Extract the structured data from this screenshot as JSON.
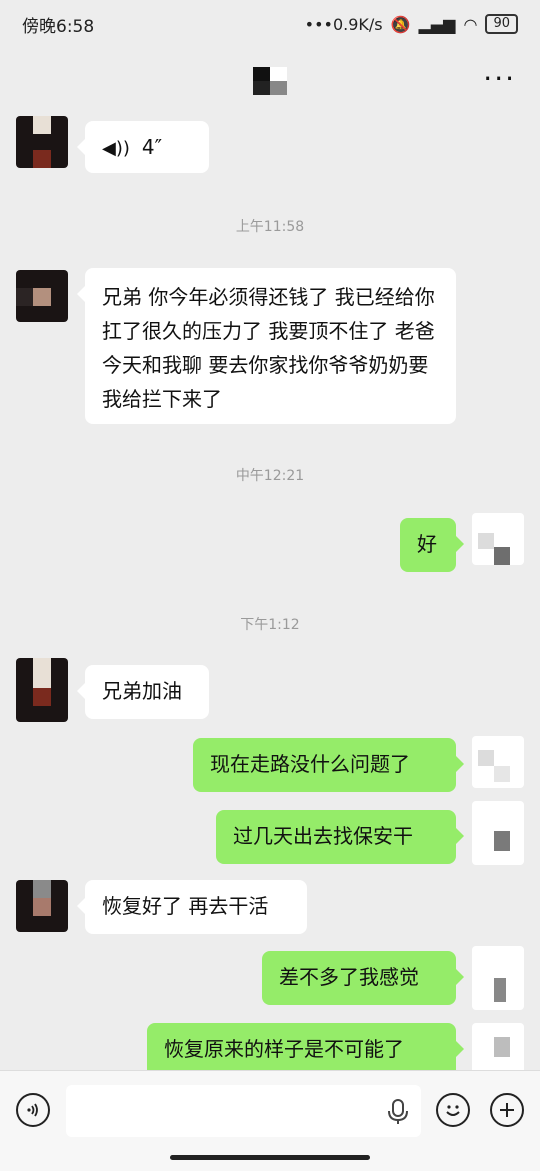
{
  "status": {
    "time": "傍晚6:58",
    "speed": "•••0.9K/s",
    "battery": "90"
  },
  "messages": {
    "voice_duration": "4″",
    "ts1": "上午11:58",
    "m1": "兄弟 你今年必须得还钱了 我已经给你扛了很久的压力了 我要顶不住了 老爸今天和我聊 要去你家找你爷爷奶奶要 我给拦下来了",
    "ts2": "中午12:21",
    "m2": "好",
    "ts3": "下午1:12",
    "m3": "兄弟加油",
    "m4": "现在走路没什么问题了",
    "m5": "过几天出去找保安干",
    "m6": "恢复好了 再去干活",
    "m7": "差不多了我感觉",
    "m8": "恢复原来的样子是不可能了"
  },
  "icons": {
    "more": "more-dots-icon",
    "voice": "voice-icon",
    "emoji": "emoji-icon",
    "add": "plus-icon",
    "mic": "microphone-icon"
  }
}
